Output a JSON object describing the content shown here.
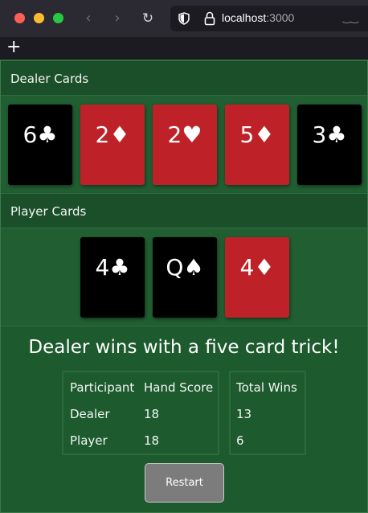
{
  "browser": {
    "url_host": "localhost",
    "url_port": ":3000",
    "back_icon": "‹",
    "forward_icon": "›",
    "reload_icon": "↻",
    "new_tab_icon": "+"
  },
  "dealer": {
    "title": "Dealer Cards",
    "cards": [
      {
        "label": "6♣",
        "color": "black"
      },
      {
        "label": "2♦",
        "color": "red"
      },
      {
        "label": "2♥",
        "color": "red"
      },
      {
        "label": "5♦",
        "color": "red"
      },
      {
        "label": "3♣",
        "color": "black"
      }
    ]
  },
  "player": {
    "title": "Player Cards",
    "cards": [
      {
        "label": "4♣",
        "color": "black"
      },
      {
        "label": "Q♠",
        "color": "black"
      },
      {
        "label": "4♦",
        "color": "red"
      }
    ]
  },
  "result_message": "Dealer wins with a five card trick!",
  "score_table": {
    "headers": {
      "participant": "Participant",
      "hand_score": "Hand Score",
      "total_wins": "Total Wins"
    },
    "rows": [
      {
        "participant": "Dealer",
        "hand_score": "18",
        "total_wins": "13"
      },
      {
        "participant": "Player",
        "hand_score": "18",
        "total_wins": "6"
      }
    ]
  },
  "restart_label": "Restart",
  "colors": {
    "felt": "#215f32",
    "header_band": "#1b4f29",
    "red_card": "#be2127",
    "black_card": "#000000",
    "button": "#7c7c7c"
  }
}
